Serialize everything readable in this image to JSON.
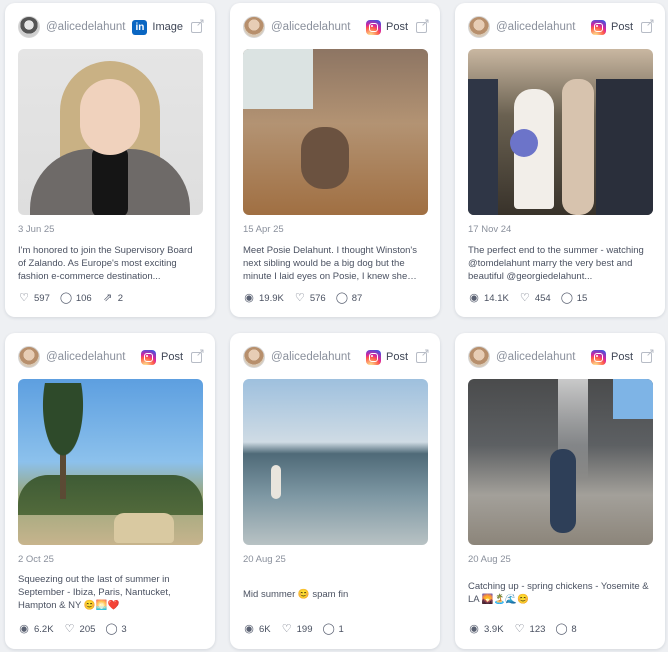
{
  "cards": [
    {
      "handle": "@alicedelahunt",
      "type_label": "Image",
      "platform_icon": "linkedin-icon",
      "date": "3 Jun 25",
      "caption": "I'm honored to join the Supervisory Board of Zalando. As Europe's most exciting fashion e-commerce destination...",
      "stats": {
        "likes": "597",
        "comments": "106",
        "shares": "2"
      }
    },
    {
      "handle": "@alicedelahunt",
      "type_label": "Post",
      "platform_icon": "instagram-icon",
      "date": "15 Apr 25",
      "caption": "Meet Posie Delahunt. I thought Winston's next sibling would be a big dog but the minute I laid eyes on Posie, I knew she wa...",
      "stats": {
        "views": "19.9K",
        "likes": "576",
        "comments": "87"
      }
    },
    {
      "handle": "@alicedelahunt",
      "type_label": "Post",
      "platform_icon": "instagram-icon",
      "date": "17 Nov 24",
      "caption": "The perfect end to the summer - watching @tomdelahunt marry the very best and beautiful @georgiedelahunt...",
      "stats": {
        "views": "14.1K",
        "likes": "454",
        "comments": "15"
      }
    },
    {
      "handle": "@alicedelahunt",
      "type_label": "Post",
      "platform_icon": "instagram-icon",
      "date": "2 Oct 25",
      "caption": "Squeezing out the last of summer in September - Ibiza, Paris, Nantucket, Hampton & NY 😊🌅❤️",
      "stats": {
        "views": "6.2K",
        "likes": "205",
        "comments": "3"
      }
    },
    {
      "handle": "@alicedelahunt",
      "type_label": "Post",
      "platform_icon": "instagram-icon",
      "date": "20 Aug 25",
      "caption": "Mid summer 😊 spam fin",
      "stats": {
        "views": "6K",
        "likes": "199",
        "comments": "1"
      }
    },
    {
      "handle": "@alicedelahunt",
      "type_label": "Post",
      "platform_icon": "instagram-icon",
      "date": "20 Aug 25",
      "caption": "Catching up - spring chickens - Yosemite & LA 🌄🏝️🌊😊",
      "stats": {
        "views": "3.9K",
        "likes": "123",
        "comments": "8"
      }
    }
  ],
  "icons": {
    "external": "external-link-icon",
    "views": "eye-icon",
    "likes": "heart-icon",
    "comments": "comment-icon",
    "shares": "share-icon"
  }
}
